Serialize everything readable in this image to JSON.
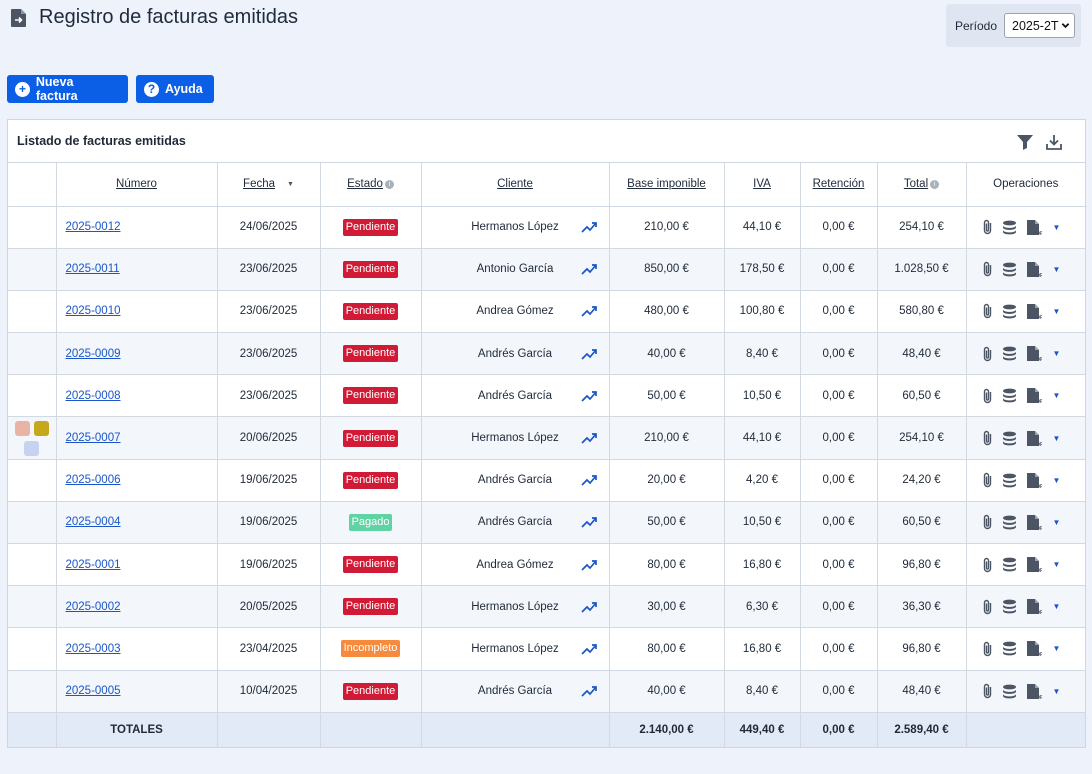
{
  "header": {
    "title": "Registro de facturas emitidas"
  },
  "period": {
    "label": "Período",
    "value": "2025-2T"
  },
  "toolbar": {
    "new_label": "Nueva factura",
    "help_label": "Ayuda"
  },
  "panel": {
    "title": "Listado de facturas emitidas"
  },
  "columns": {
    "numero": "Número",
    "fecha": "Fecha",
    "estado": "Estado",
    "cliente": "Cliente",
    "base": "Base imponible",
    "iva": "IVA",
    "retencion": "Retención",
    "total": "Total",
    "operaciones": "Operaciones"
  },
  "rows": [
    {
      "numero": "2025-0012",
      "fecha": "24/06/2025",
      "estado": "Pendiente",
      "cliente": "Hermanos López",
      "base": "210,00 €",
      "iva": "44,10 €",
      "ret": "0,00 €",
      "total": "254,10 €"
    },
    {
      "numero": "2025-0011",
      "fecha": "23/06/2025",
      "estado": "Pendiente",
      "cliente": "Antonio García",
      "base": "850,00 €",
      "iva": "178,50 €",
      "ret": "0,00 €",
      "total": "1.028,50 €"
    },
    {
      "numero": "2025-0010",
      "fecha": "23/06/2025",
      "estado": "Pendiente",
      "cliente": "Andrea Gómez",
      "base": "480,00 €",
      "iva": "100,80 €",
      "ret": "0,00 €",
      "total": "580,80 €"
    },
    {
      "numero": "2025-0009",
      "fecha": "23/06/2025",
      "estado": "Pendiente",
      "cliente": "Andrés García",
      "base": "40,00 €",
      "iva": "8,40 €",
      "ret": "0,00 €",
      "total": "48,40 €"
    },
    {
      "numero": "2025-0008",
      "fecha": "23/06/2025",
      "estado": "Pendiente",
      "cliente": "Andrés García",
      "base": "50,00 €",
      "iva": "10,50 €",
      "ret": "0,00 €",
      "total": "60,50 €"
    },
    {
      "numero": "2025-0007",
      "fecha": "20/06/2025",
      "estado": "Pendiente",
      "cliente": "Hermanos López",
      "base": "210,00 €",
      "iva": "44,10 €",
      "ret": "0,00 €",
      "total": "254,10 €"
    },
    {
      "numero": "2025-0006",
      "fecha": "19/06/2025",
      "estado": "Pendiente",
      "cliente": "Andrés García",
      "base": "20,00 €",
      "iva": "4,20 €",
      "ret": "0,00 €",
      "total": "24,20 €"
    },
    {
      "numero": "2025-0004",
      "fecha": "19/06/2025",
      "estado": "Pagado",
      "cliente": "Andrés García",
      "base": "50,00 €",
      "iva": "10,50 €",
      "ret": "0,00 €",
      "total": "60,50 €"
    },
    {
      "numero": "2025-0001",
      "fecha": "19/06/2025",
      "estado": "Pendiente",
      "cliente": "Andrea Gómez",
      "base": "80,00 €",
      "iva": "16,80 €",
      "ret": "0,00 €",
      "total": "96,80 €"
    },
    {
      "numero": "2025-0002",
      "fecha": "20/05/2025",
      "estado": "Pendiente",
      "cliente": "Hermanos López",
      "base": "30,00 €",
      "iva": "6,30 €",
      "ret": "0,00 €",
      "total": "36,30 €"
    },
    {
      "numero": "2025-0003",
      "fecha": "23/04/2025",
      "estado": "Incompleto",
      "cliente": "Hermanos López",
      "base": "80,00 €",
      "iva": "16,80 €",
      "ret": "0,00 €",
      "total": "96,80 €"
    },
    {
      "numero": "2025-0005",
      "fecha": "10/04/2025",
      "estado": "Pendiente",
      "cliente": "Andrés García",
      "base": "40,00 €",
      "iva": "8,40 €",
      "ret": "0,00 €",
      "total": "48,40 €"
    }
  ],
  "totals": {
    "label": "TOTALES",
    "base": "2.140,00 €",
    "iva": "449,40 €",
    "ret": "0,00 €",
    "total": "2.589,40 €"
  },
  "status_colors": {
    "Pendiente": "#d11a35",
    "Pagado": "#5fd3a4",
    "Incompleto": "#f68a3d"
  },
  "tag_colors": [
    "#e8b4a6",
    "#c6a81a",
    "#c5d3f0"
  ],
  "icons": {
    "doc": "file-arrow-icon",
    "filter": "filter-icon",
    "download": "download-icon",
    "trend": "trend-icon"
  }
}
